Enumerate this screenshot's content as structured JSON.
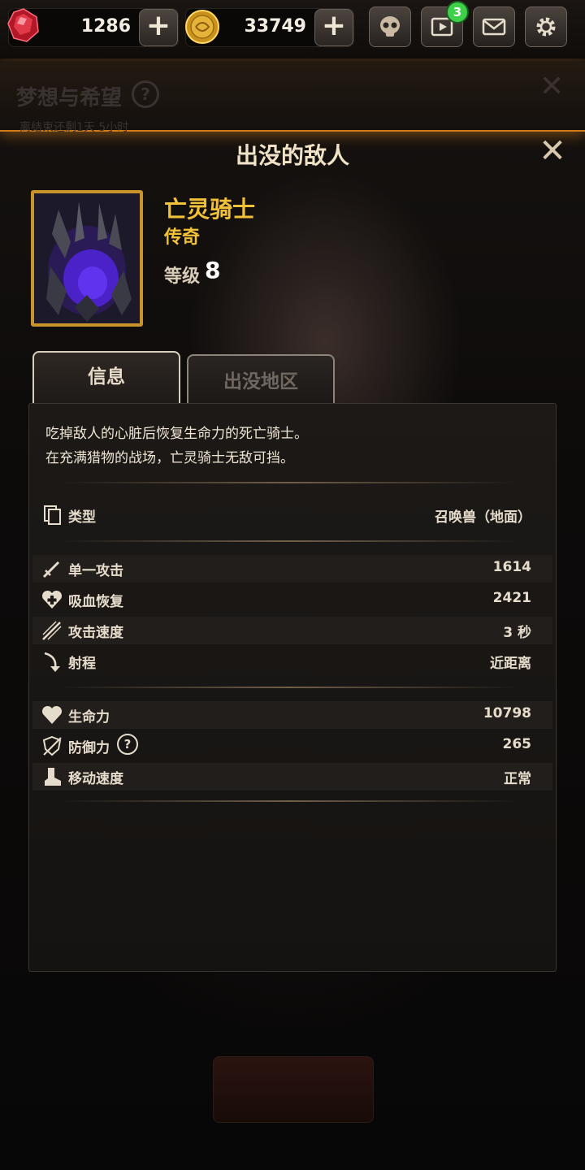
{
  "topbar": {
    "gems": "1286",
    "gold": "33749",
    "video_badge": "3",
    "icons": [
      "gem-icon",
      "gold-coin-icon",
      "skull-icon",
      "video-icon",
      "mail-icon",
      "gear-icon"
    ]
  },
  "background_screen": {
    "title": "梦想与希望",
    "help": "?",
    "subtitle": "离结束还剩1天 5小时",
    "close": "✕"
  },
  "modal": {
    "title": "出没的敌人",
    "close": "✕",
    "enemy": {
      "name": "亡灵骑士",
      "rarity": "传奇",
      "level_label": "等级",
      "level": "8"
    },
    "tabs": [
      {
        "label": "信息",
        "active": true
      },
      {
        "label": "出没地区",
        "active": false
      }
    ],
    "description": [
      "吃掉敌人的心脏后恢复生命力的死亡骑士。",
      "在充满猎物的战场，亡灵骑士无敌可挡。"
    ],
    "type_row": {
      "label": "类型",
      "value": "召唤兽（地面）",
      "icon": "card-icon"
    },
    "attack_stats": [
      {
        "label": "单一攻击",
        "value": "1614",
        "icon": "sword-icon"
      },
      {
        "label": "吸血恢复",
        "value": "2421",
        "icon": "heart-plus-icon"
      },
      {
        "label": "攻击速度",
        "value": "3 秒",
        "icon": "attack-speed-icon"
      },
      {
        "label": "射程",
        "value": "近距离",
        "icon": "range-icon"
      }
    ],
    "defense_stats": [
      {
        "label": "生命力",
        "value": "10798",
        "icon": "heart-icon"
      },
      {
        "label": "防御力",
        "value": "265",
        "icon": "shield-icon",
        "help": "?"
      },
      {
        "label": "移动速度",
        "value": "正常",
        "icon": "boot-icon"
      }
    ]
  },
  "colors": {
    "accent_gold": "#f2c13a",
    "header_glow": "#d07a18",
    "badge_green": "#3fd04a"
  }
}
